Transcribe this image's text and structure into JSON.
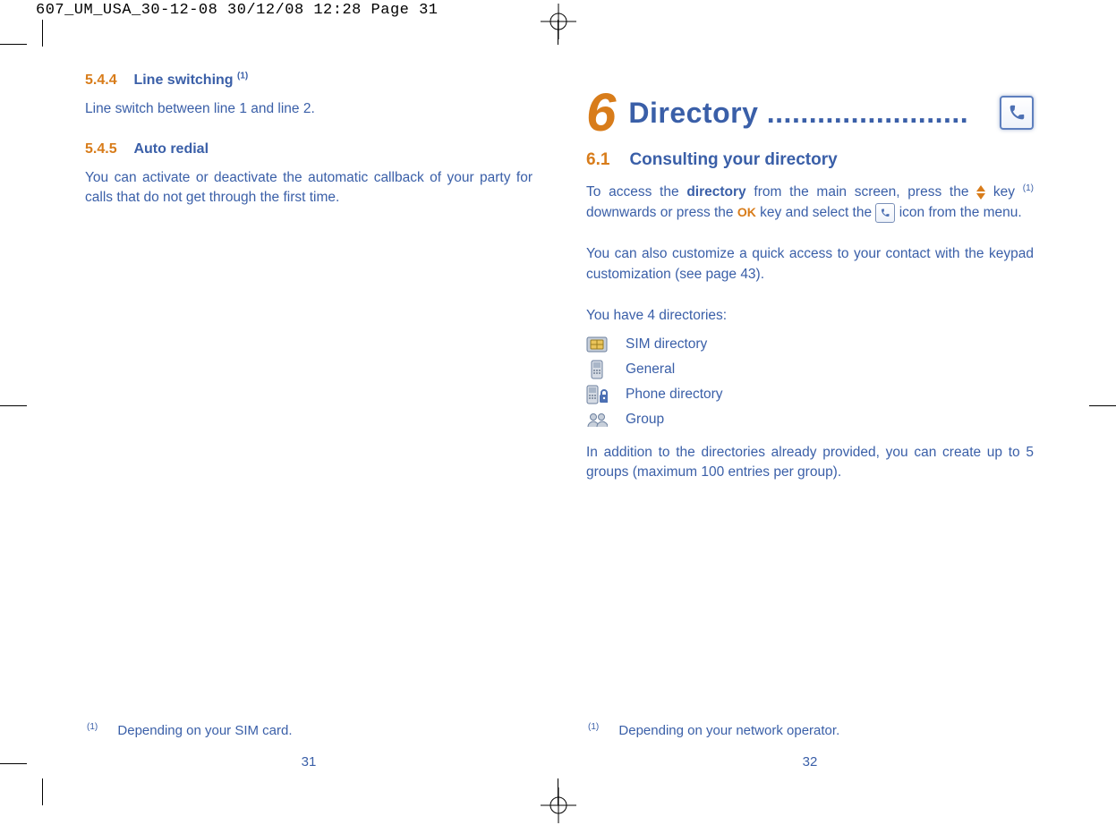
{
  "prepress_slug": "607_UM_USA_30-12-08  30/12/08  12:28  Page 31",
  "left_page": {
    "sec1_num": "5.4.4",
    "sec1_title": "Line switching",
    "sec1_sup": "(1)",
    "sec1_para": "Line switch between line 1 and line 2.",
    "sec2_num": "5.4.5",
    "sec2_title": "Auto redial",
    "sec2_para": "You can activate or deactivate the automatic callback of your party for calls that do not get through the first time.",
    "footnote_sup": "(1)",
    "footnote_text": "Depending on your SIM card.",
    "page_num": "31"
  },
  "right_page": {
    "chapter_num": "6",
    "chapter_title": "Directory ........................",
    "h2_num": "6.1",
    "h2_title": "Consulting your directory",
    "para1_a": "To access the ",
    "para1_bold1": "directory",
    "para1_b": " from the main screen, press the ",
    "para1_c": " key ",
    "para1_sup": "(1)",
    "para1_d": " downwards or press the ",
    "para1_ok": "OK",
    "para1_e": " key and select the ",
    "para1_f": " icon from the menu.",
    "para2": "You can also customize a quick access to your contact with the keypad customization (see page 43).",
    "para3": "You have 4 directories:",
    "dirs": [
      "SIM directory",
      "General",
      "Phone directory",
      "Group"
    ],
    "para4": "In addition to the directories already provided, you can create up to 5 groups (maximum 100 entries per group).",
    "footnote_sup": "(1)",
    "footnote_text": "Depending on your network operator.",
    "page_num": "32"
  }
}
